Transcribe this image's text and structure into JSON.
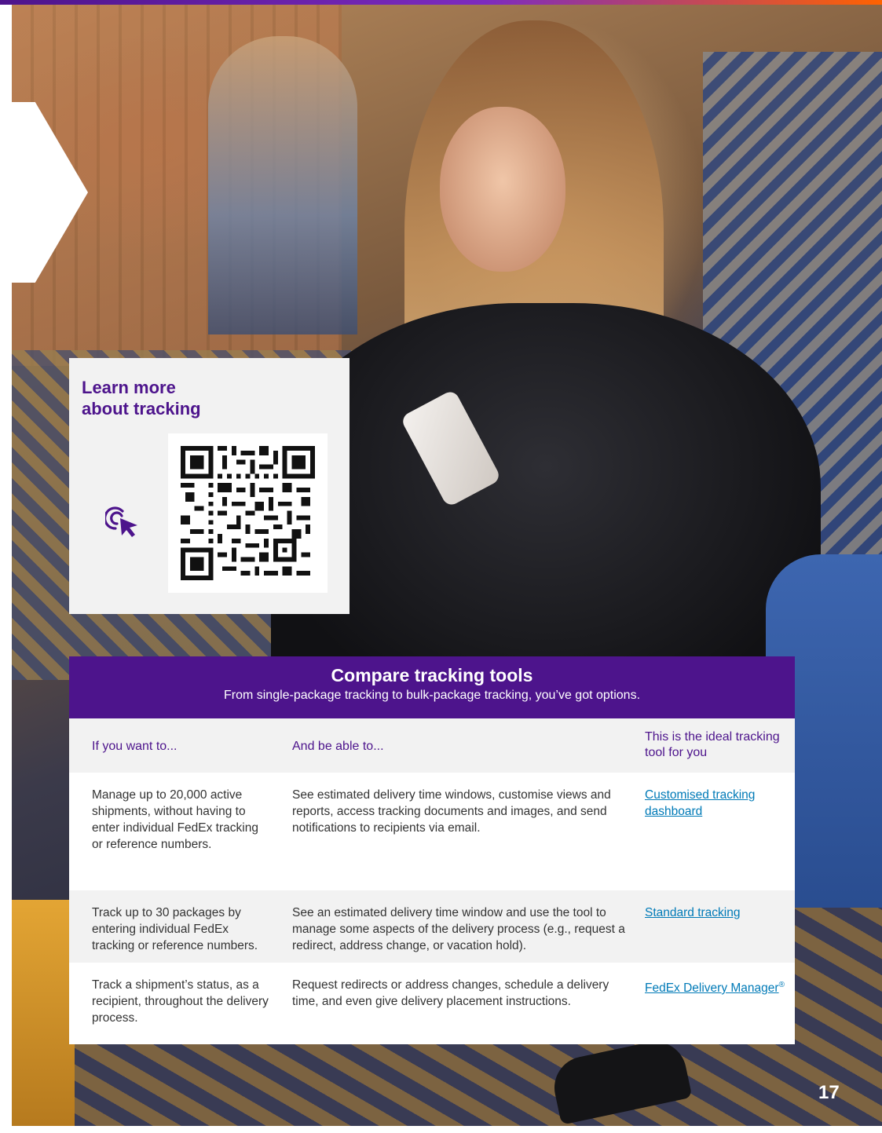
{
  "learn_more": {
    "title_line1": "Learn more",
    "title_line2": "about tracking",
    "icon": "click-pointer-icon",
    "qr_code": "qr-code"
  },
  "compare": {
    "title": "Compare tracking tools",
    "subtitle": "From single-package tracking to bulk-package tracking, you’ve got options.",
    "columns": [
      "If you want to...",
      "And be able to...",
      "This is the ideal tracking tool for you"
    ],
    "rows": [
      {
        "want": "Manage up to 20,000 active shipments, without having to enter individual FedEx tracking or reference numbers.",
        "able": "See estimated delivery time windows, customise views and reports, access tracking documents and images, and send notifications to recipients via email.",
        "tool": "Customised tracking dashboard"
      },
      {
        "want": "Track up to 30 packages by entering individual FedEx tracking or reference numbers.",
        "able": "See an estimated delivery time window and use the tool to manage some aspects of the delivery process (e.g., request a redirect, address change, or vacation hold).",
        "tool": "Standard tracking"
      },
      {
        "want": "Track a shipment’s status, as a recipient, throughout the delivery process.",
        "able": "Request redirects or address changes, schedule a delivery time, and even give delivery placement instructions.",
        "tool": "FedEx Delivery Manager",
        "tool_mark": "®"
      }
    ]
  },
  "page_number": "17",
  "colors": {
    "brand_purple": "#4d148c",
    "link_blue": "#007ab7",
    "accent_orange": "#ff6200"
  }
}
